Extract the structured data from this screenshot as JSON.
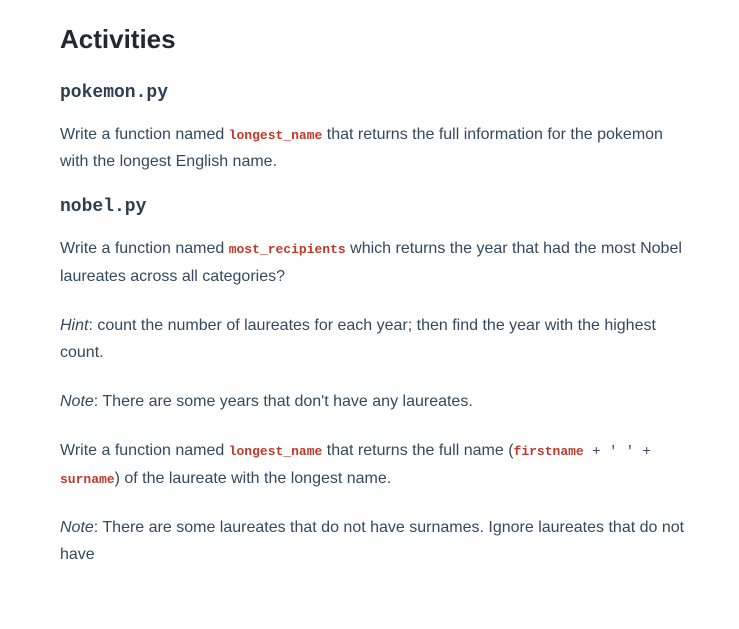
{
  "heading": "Activities",
  "sections": [
    {
      "id": "pokemon",
      "title": "pokemon.py",
      "paragraphs": [
        {
          "pre1": "Write a function named ",
          "code1": "longest_name",
          "post1": " that returns the full information for the pokemon with the longest English name."
        }
      ]
    },
    {
      "id": "nobel",
      "title": "nobel.py",
      "paragraphs": [
        {
          "pre1": "Write a function named ",
          "code1": "most_recipients",
          "post1": " which returns the year that had the most Nobel laureates across all categories?"
        },
        {
          "emph": "Hint",
          "rest": ": count the number of laureates for each year; then find the year with the highest count."
        },
        {
          "emph": "Note",
          "rest": ": There are some years that don't have any laureates."
        },
        {
          "pre1": "Write a function named ",
          "code1": "longest_name",
          "mid1": " that returns the full name (",
          "code2": "firstname",
          "sym1": " + ' ' + ",
          "code3": "surname",
          "post1": ") of the laureate with the longest name."
        },
        {
          "emph": "Note",
          "rest": ": There are some laureates that do not have surnames. Ignore laureates that do not have"
        }
      ]
    }
  ]
}
